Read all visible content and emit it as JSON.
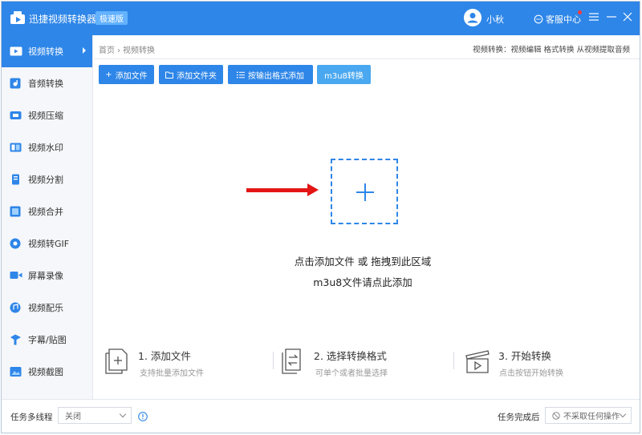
{
  "app": {
    "title": "迅捷视频转换器",
    "edition_badge": "极速版",
    "user_name": "小秋",
    "service_label": "客服中心",
    "accent": "#2e86e8"
  },
  "sidebar": {
    "items": [
      {
        "label": "视频转换",
        "icon": "video-convert-icon",
        "active": true
      },
      {
        "label": "音频转换",
        "icon": "audio-convert-icon"
      },
      {
        "label": "视频压缩",
        "icon": "video-compress-icon"
      },
      {
        "label": "视频水印",
        "icon": "video-watermark-icon"
      },
      {
        "label": "视频分割",
        "icon": "video-split-icon"
      },
      {
        "label": "视频合并",
        "icon": "video-merge-icon"
      },
      {
        "label": "视频转GIF",
        "icon": "video-to-gif-icon"
      },
      {
        "label": "屏幕录像",
        "icon": "screen-record-icon"
      },
      {
        "label": "视频配乐",
        "icon": "video-music-icon"
      },
      {
        "label": "字幕/贴图",
        "icon": "subtitle-sticker-icon"
      },
      {
        "label": "视频截图",
        "icon": "video-screenshot-icon"
      }
    ]
  },
  "breadcrumb": {
    "home": "首页",
    "separator": "›",
    "current": "视频转换"
  },
  "top_links": "视频转换：视频编辑 格式转换 从视频提取音频",
  "toolbar": {
    "add_file": "添加文件",
    "add_folder": "添加文件夹",
    "add_by_format": "按输出格式添加",
    "m3u8": "m3u8转换"
  },
  "dropzone": {
    "hint_line1": "点击添加文件 或 拖拽到此区域",
    "hint_line2": "m3u8文件请点此添加"
  },
  "steps": [
    {
      "title": "1. 添加文件",
      "desc": "支持批量添加文件"
    },
    {
      "title": "2. 选择转换格式",
      "desc": "可单个或者批量选择"
    },
    {
      "title": "3. 开始转换",
      "desc": "点击按钮开始转换"
    }
  ],
  "bottom": {
    "multithread_label": "任务多线程",
    "multithread_value": "关闭",
    "after_done_label": "任务完成后",
    "after_done_value": "不采取任何操作"
  }
}
